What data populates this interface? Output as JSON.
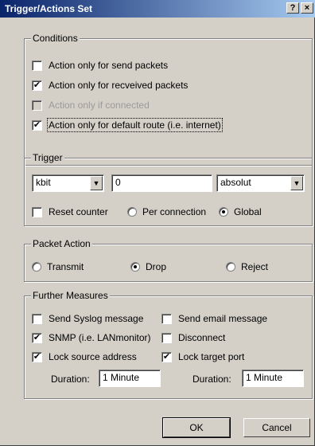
{
  "title": "Trigger/Actions Set",
  "help_label": "?",
  "close_label": "×",
  "conditions": {
    "legend": "Conditions",
    "items": [
      {
        "label": "Action only for send packets",
        "mark": ""
      },
      {
        "label": "Action only for recveived packets",
        "mark": "✔"
      },
      {
        "label": "Action only if connected",
        "mark": ""
      },
      {
        "label": "Action only for default route (i.e. internet)",
        "mark": "✔"
      }
    ]
  },
  "trigger": {
    "legend": "Trigger",
    "unit": "kbit",
    "value": "0",
    "mode": "absolut",
    "reset_label": "Reset counter",
    "reset_mark": "",
    "per_connection_label": "Per connection",
    "global_label": "Global",
    "scope": "Global"
  },
  "packet_action": {
    "legend": "Packet Action",
    "transmit_label": "Transmit",
    "drop_label": "Drop",
    "reject_label": "Reject",
    "selected": "Drop"
  },
  "further": {
    "legend": "Further Measures",
    "send_syslog_label": "Send Syslog message",
    "send_syslog_mark": "",
    "send_email_label": "Send email message",
    "send_email_mark": "",
    "snmp_label": "SNMP (i.e. LANmonitor)",
    "snmp_mark": "✔",
    "disconnect_label": "Disconnect",
    "disconnect_mark": "",
    "lock_source_label": "Lock source address",
    "lock_source_mark": "✔",
    "lock_target_label": "Lock target port",
    "lock_target_mark": "✔",
    "duration_label": "Duration:",
    "duration_left": "1 Minute",
    "duration_right": "1 Minute"
  },
  "buttons": {
    "ok": "OK",
    "cancel": "Cancel"
  }
}
